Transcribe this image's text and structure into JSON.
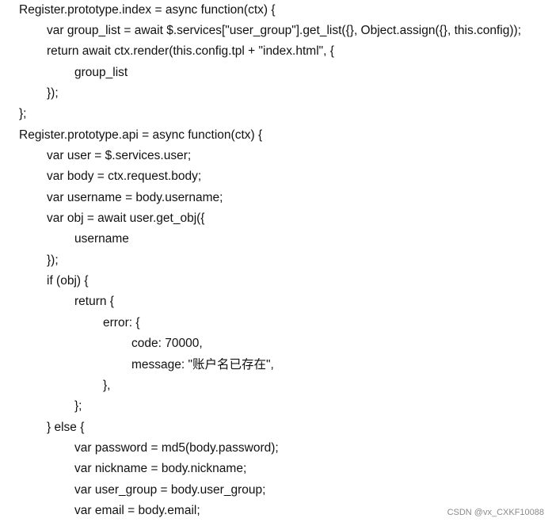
{
  "document": {
    "code_lines": [
      {
        "indent": 0,
        "text": "Register.prototype.index = async function(ctx) {"
      },
      {
        "indent": 1,
        "text": "var group_list = await $.services[\"user_group\"].get_list({}, Object.assign({}, this.config));"
      },
      {
        "indent": 1,
        "text": "return await ctx.render(this.config.tpl + \"index.html\", {"
      },
      {
        "indent": 2,
        "text": "group_list"
      },
      {
        "indent": 1,
        "text": "});"
      },
      {
        "indent": 0,
        "text": "};"
      },
      {
        "indent": 0,
        "text": "Register.prototype.api = async function(ctx) {"
      },
      {
        "indent": 1,
        "text": "var user = $.services.user;"
      },
      {
        "indent": 1,
        "text": "var body = ctx.request.body;"
      },
      {
        "indent": 1,
        "text": "var username = body.username;"
      },
      {
        "indent": 1,
        "text": "var obj = await user.get_obj({"
      },
      {
        "indent": 2,
        "text": "username"
      },
      {
        "indent": 1,
        "text": "});"
      },
      {
        "indent": 1,
        "text": "if (obj) {"
      },
      {
        "indent": 2,
        "text": "return {"
      },
      {
        "indent": 3,
        "text": "error: {"
      },
      {
        "indent": 4,
        "text": "code: 70000,"
      },
      {
        "indent": 4,
        "text": "message: \"账户名已存在\","
      },
      {
        "indent": 3,
        "text": "},"
      },
      {
        "indent": 2,
        "text": "};"
      },
      {
        "indent": 1,
        "text": "} else {"
      },
      {
        "indent": 2,
        "text": "var password = md5(body.password);"
      },
      {
        "indent": 2,
        "text": "var nickname = body.nickname;"
      },
      {
        "indent": 2,
        "text": "var user_group = body.user_group;"
      },
      {
        "indent": 2,
        "text": "var email = body.email;"
      }
    ]
  },
  "watermark": "CSDN @vx_CXKF10088"
}
